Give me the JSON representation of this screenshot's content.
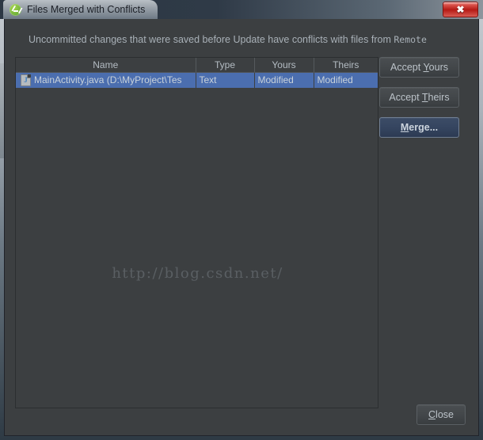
{
  "window": {
    "title": "Files Merged with Conflicts",
    "app_icon": "android-studio-icon",
    "close_glyph": "✖"
  },
  "dialog": {
    "message_prefix": "Uncommitted changes that were saved before Update have conflicts with files from ",
    "message_source": "Remote"
  },
  "table": {
    "columns": [
      "Name",
      "Type",
      "Yours",
      "Theirs"
    ],
    "rows": [
      {
        "icon": "java-file-icon",
        "name": "MainActivity.java (D:\\MyProject\\Tes",
        "type": "Text",
        "yours": "Modified",
        "theirs": "Modified",
        "selected": true
      }
    ],
    "selection_color": "#4b6eaf"
  },
  "watermark": {
    "text": "http://blog.csdn.net/"
  },
  "buttons": {
    "accept_yours": {
      "pre": "Accept ",
      "mnemonic": "Y",
      "post": "ours"
    },
    "accept_theirs": {
      "pre": "Accept ",
      "mnemonic": "T",
      "post": "heirs"
    },
    "merge": {
      "pre": "",
      "mnemonic": "M",
      "post": "erge..."
    },
    "close": {
      "pre": "",
      "mnemonic": "C",
      "post": "lose"
    }
  }
}
